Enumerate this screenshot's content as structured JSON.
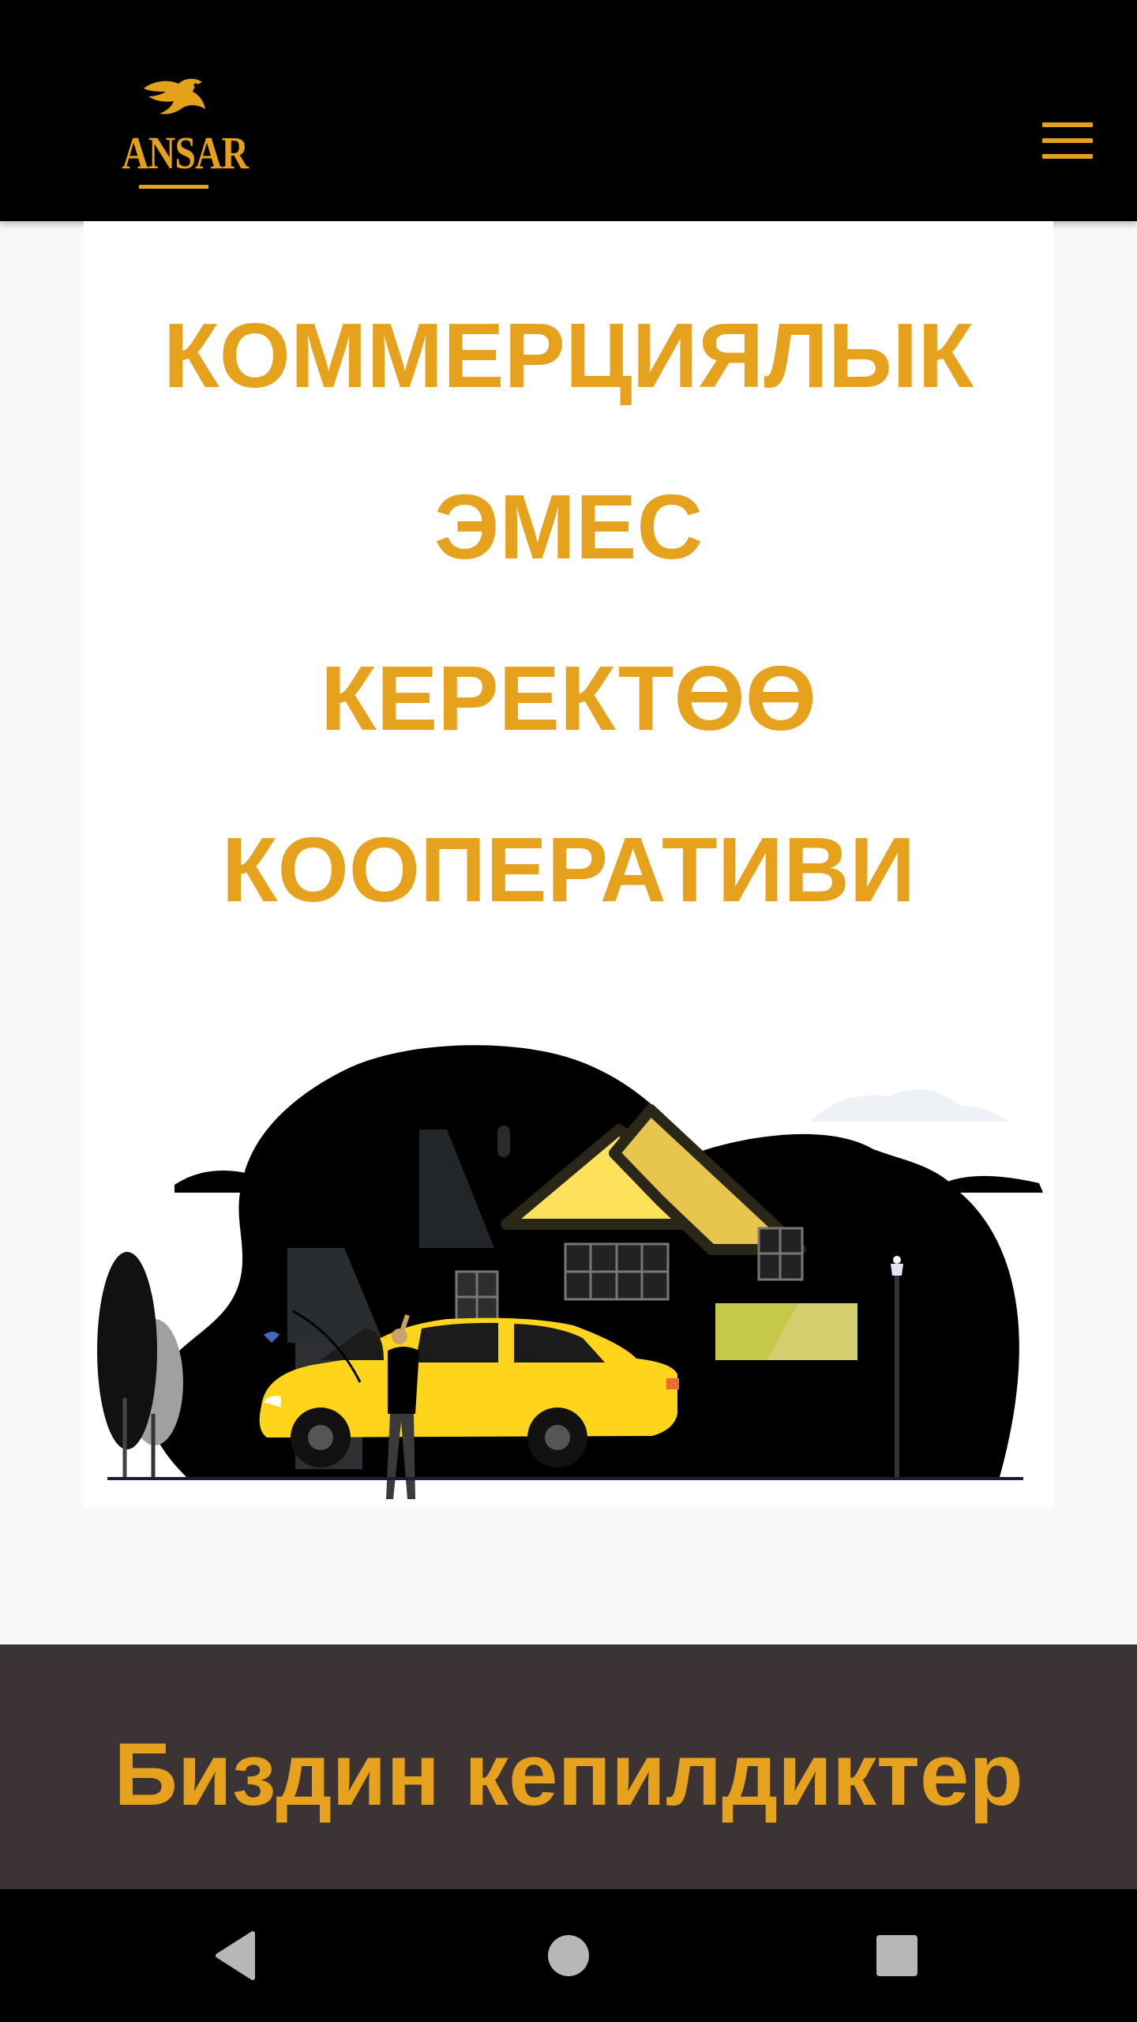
{
  "header": {
    "logo_text": "ANSAR",
    "menu_icon": "hamburger-menu-icon",
    "accent_color": "#e3a21a",
    "background_color": "#000000"
  },
  "hero": {
    "title_lines": [
      "КОММЕРЦИЯЛЫК",
      "ЭМЕС",
      "КЕРЕКТӨӨ",
      "КООПЕРАТИВИ"
    ],
    "title_color": "#e6a21d",
    "illustration": "taxi-house-illustration"
  },
  "guarantees": {
    "title": "Биздин кепилдиктер",
    "background_color": "#3c3334"
  },
  "system_nav": {
    "back_icon": "back-triangle-icon",
    "home_icon": "home-circle-icon",
    "recents_icon": "recents-square-icon"
  }
}
